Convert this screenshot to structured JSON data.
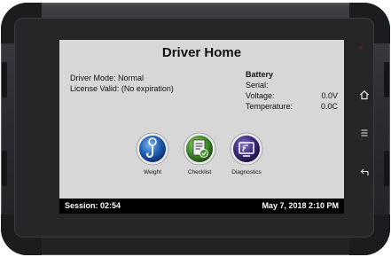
{
  "screen": {
    "title": "Driver Home",
    "driver_mode": "Driver Mode: Normal",
    "license_valid": "License Valid: (No expiration)",
    "battery": {
      "heading": "Battery",
      "serial_label": "Serial:",
      "serial_value": "",
      "voltage_label": "Voltage:",
      "voltage_value": "0.0V",
      "temperature_label": "Temperature:",
      "temperature_value": "0.0C"
    },
    "tiles": [
      {
        "label": "Weight",
        "icon": "weight-scale-icon",
        "color": "#1f5fb0"
      },
      {
        "label": "Checklist",
        "icon": "checklist-icon",
        "color": "#3f8a2a"
      },
      {
        "label": "Diagnostics",
        "icon": "diagnostics-icon",
        "color": "#3e2a7a"
      }
    ],
    "status": {
      "session": "Session: 02:54",
      "datetime": "May 7, 2018 2:10 PM"
    }
  },
  "hardware_keys": [
    {
      "icon": "home-icon"
    },
    {
      "icon": "menu-icon"
    },
    {
      "icon": "back-icon"
    }
  ]
}
